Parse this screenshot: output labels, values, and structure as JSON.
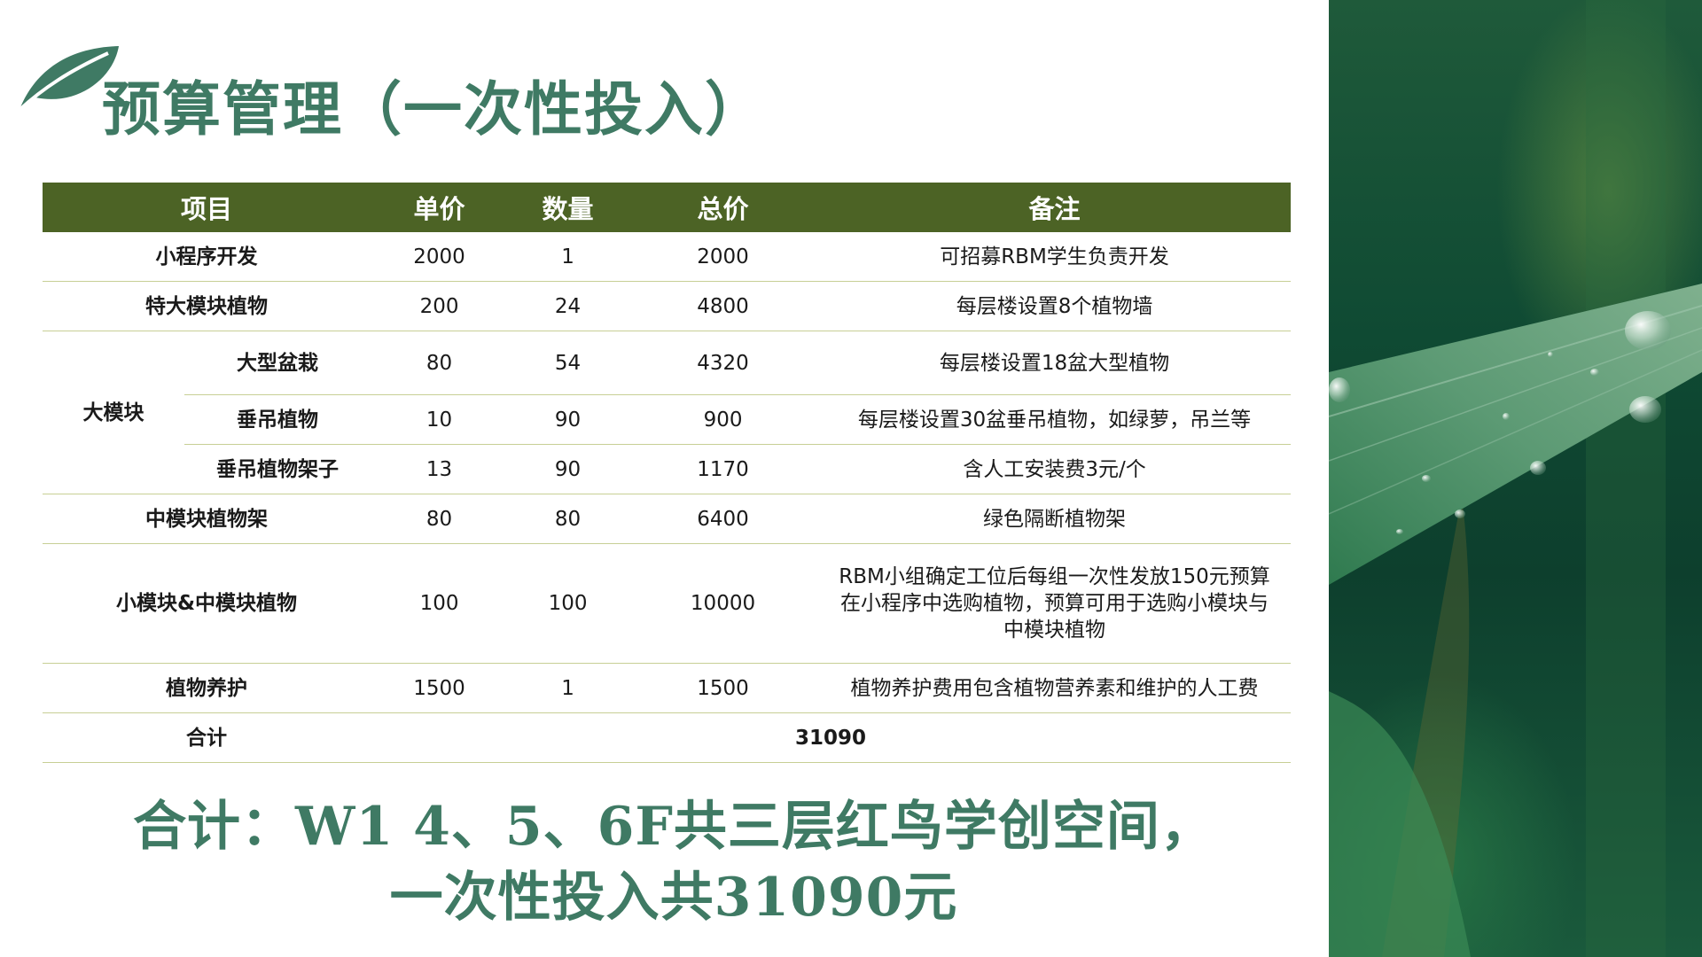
{
  "title": "预算管理（一次性投入）",
  "table": {
    "headers": [
      "项目",
      "单价",
      "数量",
      "总价",
      "备注"
    ],
    "rows": [
      {
        "item": "小程序开发",
        "unit": "2000",
        "qty": "1",
        "total": "2000",
        "note": "可招募RBM学生负责开发"
      },
      {
        "item": "特大模块植物",
        "unit": "200",
        "qty": "24",
        "total": "4800",
        "note": "每层楼设置8个植物墙"
      },
      {
        "group": "大模块",
        "item": "大型盆栽",
        "unit": "80",
        "qty": "54",
        "total": "4320",
        "note": "每层楼设置18盆大型植物"
      },
      {
        "item": "垂吊植物",
        "unit": "10",
        "qty": "90",
        "total": "900",
        "note": "每层楼设置30盆垂吊植物，如绿萝，吊兰等"
      },
      {
        "item": "垂吊植物架子",
        "unit": "13",
        "qty": "90",
        "total": "1170",
        "note": "含人工安装费3元/个"
      },
      {
        "item": "中模块植物架",
        "unit": "80",
        "qty": "80",
        "total": "6400",
        "note": "绿色隔断植物架"
      },
      {
        "item": "小模块&中模块植物",
        "unit": "100",
        "qty": "100",
        "total": "10000",
        "note": "RBM小组确定工位后每组一次性发放150元预算在小程序中选购植物，预算可用于选购小模块与中模块植物"
      },
      {
        "item": "植物养护",
        "unit": "1500",
        "qty": "1",
        "total": "1500",
        "note": "植物养护费用包含植物营养素和维护的人工费"
      }
    ],
    "total_label": "合计",
    "total_value": "31090"
  },
  "summary": {
    "line1": "合计：W1 4、5、6F共三层红鸟学创空间，",
    "line2": "一次性投入共31090元"
  },
  "colors": {
    "header_bg": "#4c6325",
    "title": "#3f7a64",
    "row_divider": "#c7cf95"
  },
  "icons": [
    "leaf-icon"
  ]
}
